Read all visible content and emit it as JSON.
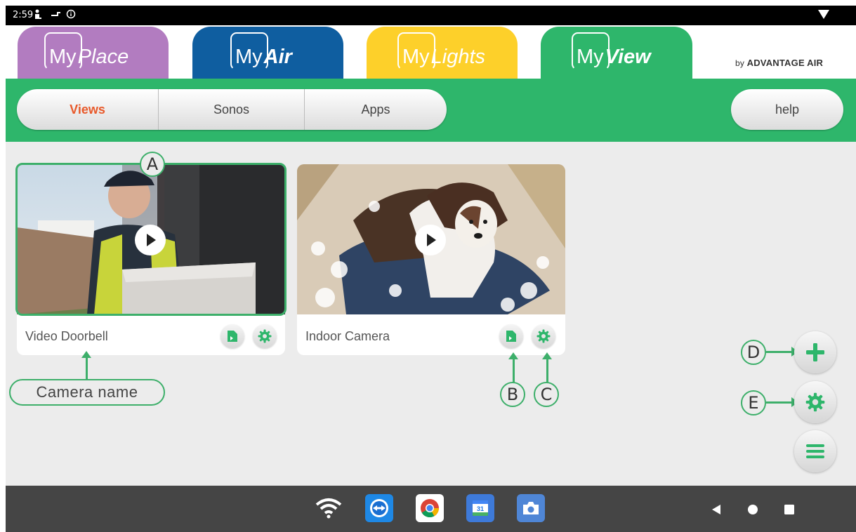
{
  "status": {
    "time": "2:59",
    "icons": [
      "person-icon",
      "network-icon",
      "info-icon",
      "wifi-icon"
    ]
  },
  "app_tabs": [
    {
      "my": "My",
      "name": "Place",
      "color": "#b27cc0"
    },
    {
      "my": "My",
      "name": "Air",
      "color": "#0f5ea0"
    },
    {
      "my": "My",
      "name": "Lights",
      "color": "#fdd02a"
    },
    {
      "my": "My",
      "name": "View",
      "color": "#2eb66b"
    }
  ],
  "brand": {
    "prefix": "by",
    "name": "ADVANTAGE AIR"
  },
  "nav": {
    "segments": [
      "Views",
      "Sonos",
      "Apps"
    ],
    "active": "Views",
    "help": "help"
  },
  "cameras": [
    {
      "name": "Video Doorbell",
      "selected": true
    },
    {
      "name": "Indoor Camera",
      "selected": false
    }
  ],
  "annotations": {
    "a": "A",
    "b": "B",
    "c": "C",
    "d": "D",
    "e": "E",
    "camera_name": "Camera name"
  },
  "fabs": [
    "plus-icon",
    "gear-icon",
    "menu-icon"
  ],
  "dock": [
    "wifi-icon",
    "teamviewer-icon",
    "chrome-icon",
    "calendar-icon",
    "camera-icon"
  ],
  "calendar_day": "31",
  "colors": {
    "green": "#2eb66b",
    "accent_text": "#e8592a"
  }
}
